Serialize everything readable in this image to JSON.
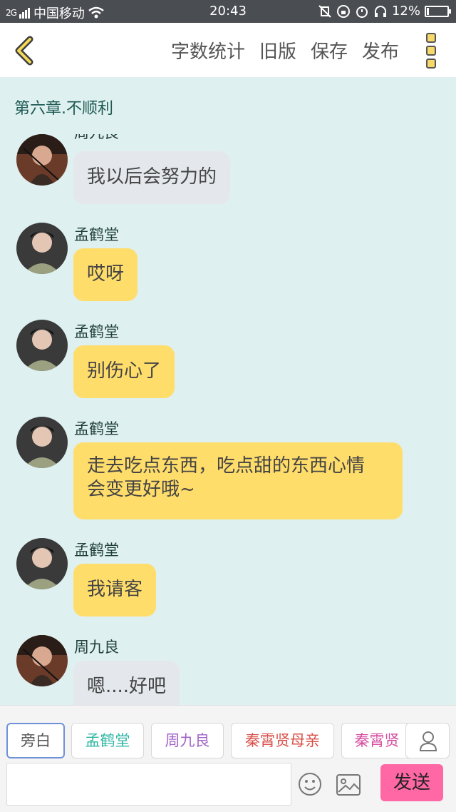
{
  "status_bar": {
    "signal": "2G",
    "carrier": "中国移动",
    "time": "20:43",
    "battery": "12%",
    "battery_level": 0.12
  },
  "toolbar": {
    "word_count": "字数统计",
    "old_version": "旧版",
    "save": "保存",
    "publish": "发布"
  },
  "chapter_title": "第六章.不顺利",
  "messages": [
    {
      "name": "周九良",
      "text": "我以后会努力的",
      "type": "other"
    },
    {
      "name": "孟鹤堂",
      "text": "哎呀",
      "type": "me"
    },
    {
      "name": "孟鹤堂",
      "text": "别伤心了",
      "type": "me"
    },
    {
      "name": "孟鹤堂",
      "text": "走去吃点东西，吃点甜的东西心情\n会变更好哦~",
      "type": "me"
    },
    {
      "name": "孟鹤堂",
      "text": "我请客",
      "type": "me"
    },
    {
      "name": "周九良",
      "text": "嗯....好吧",
      "type": "other"
    }
  ],
  "roles": [
    {
      "label": "旁白",
      "color": "#555555"
    },
    {
      "label": "孟鹤堂",
      "color": "#2eb6a4"
    },
    {
      "label": "周九良",
      "color": "#a266c9"
    },
    {
      "label": "秦霄贤母亲",
      "color": "#d8504a"
    },
    {
      "label": "秦霄贤",
      "color": "#d54ca0"
    }
  ],
  "input": {
    "placeholder": ""
  },
  "send_label": "发送",
  "colors": {
    "background": "#dff0f0",
    "my_bubble": "#ffdd6b",
    "other_bubble": "#e4e8ec",
    "send_button": "#ff67a5",
    "active_chip_border": "#6e92d8"
  },
  "icons": [
    "back-arrow-icon",
    "more-vertical-icon",
    "emoji-icon",
    "image-icon",
    "user-icon",
    "wifi-icon",
    "alarm-icon",
    "headphones-icon"
  ]
}
